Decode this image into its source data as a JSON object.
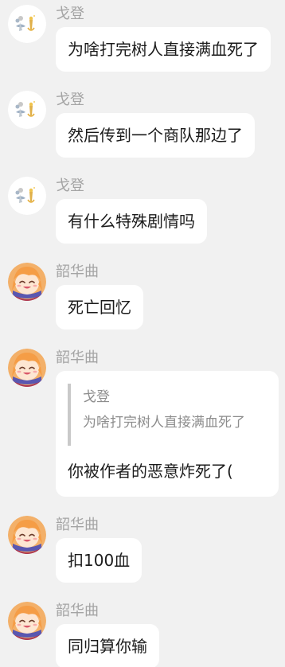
{
  "messages": [
    {
      "sender": "戈登",
      "avatar": "ge-deng-avatar",
      "text": "为啥打完树人直接满血死了"
    },
    {
      "sender": "戈登",
      "avatar": "ge-deng-avatar",
      "text": "然后传到一个商队那边了"
    },
    {
      "sender": "戈登",
      "avatar": "ge-deng-avatar",
      "text": "有什么特殊剧情吗"
    },
    {
      "sender": "韶华曲",
      "avatar": "shao-hua-qu-avatar",
      "text": "死亡回忆"
    },
    {
      "sender": "韶华曲",
      "avatar": "shao-hua-qu-avatar",
      "quote": {
        "sender": "戈登",
        "text": "为啥打完树人直接满血死了"
      },
      "text": "你被作者的恶意炸死了("
    },
    {
      "sender": "韶华曲",
      "avatar": "shao-hua-qu-avatar",
      "text": "扣100血"
    },
    {
      "sender": "韶华曲",
      "avatar": "shao-hua-qu-avatar",
      "text": "同归算你输"
    }
  ],
  "colors": {
    "background": "#f1f1f1",
    "bubble": "#ffffff",
    "sender_name": "#a4a4a4",
    "message_text": "#1b1b1b",
    "quote_text": "#8d8d8d",
    "quote_bar": "#c9c9c9"
  }
}
